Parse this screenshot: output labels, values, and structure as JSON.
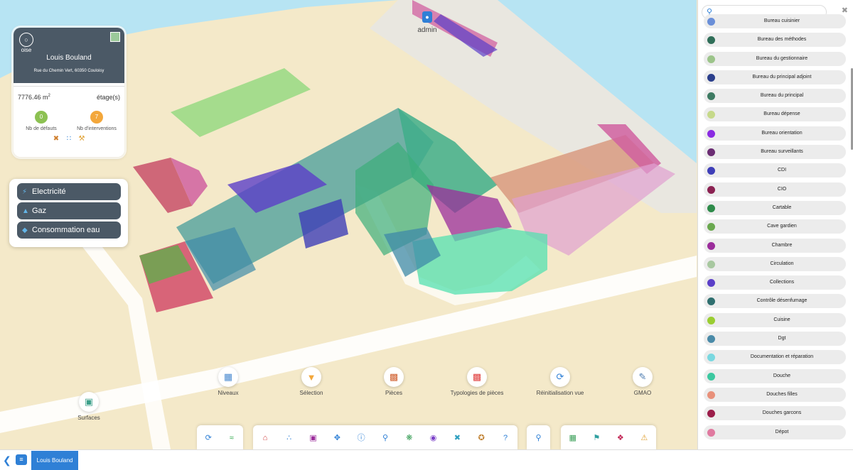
{
  "building": {
    "logo_text": "oise",
    "name": "Louis Bouland",
    "address": "Rue du Chemin Vert, 60350 Couloisy",
    "area_value": "7776.46 m",
    "area_unit_sup": "2",
    "floors_label": "étage(s)",
    "defects_count": "0",
    "defects_label": "Nb de défauts",
    "interventions_count": "7",
    "interventions_label": "Nb d'interventions",
    "defects_color": "#8cc152",
    "interventions_color": "#f3a73b"
  },
  "energy": {
    "items": [
      {
        "label": "Electricité",
        "icon": "lightning-icon"
      },
      {
        "label": "Gaz",
        "icon": "flame-icon"
      },
      {
        "label": "Consommation eau",
        "icon": "water-drop-icon"
      }
    ]
  },
  "map": {
    "user_label": "admin",
    "tools": [
      {
        "label": "Niveaux",
        "icon": "levels-icon"
      },
      {
        "label": "Sélection",
        "icon": "filter-icon"
      },
      {
        "label": "Pièces",
        "icon": "rooms-icon"
      },
      {
        "label": "Typologies de pièces",
        "icon": "room-types-icon"
      },
      {
        "label": "Réinitialisation vue",
        "icon": "reset-view-icon"
      },
      {
        "label": "GMAO",
        "icon": "gmao-icon"
      },
      {
        "label": "Surfaces",
        "icon": "surfaces-icon"
      }
    ]
  },
  "status": {
    "tab_label": "Louis Bouland"
  },
  "panel": {
    "search_placeholder": "",
    "items": [
      {
        "label": "Bureau cuisinier",
        "color": "#6a8fd8"
      },
      {
        "label": "Bureau des méthodes",
        "color": "#2f6e58"
      },
      {
        "label": "Bureau du gestionnaire",
        "color": "#9cc48a"
      },
      {
        "label": "Bureau du principal adjoint",
        "color": "#2b3f8c"
      },
      {
        "label": "Bureau du principal",
        "color": "#3e7a62"
      },
      {
        "label": "Bureau dépense",
        "color": "#c6d98a"
      },
      {
        "label": "Bureau orientation",
        "color": "#8a2be2"
      },
      {
        "label": "Bureau surveillants",
        "color": "#6b2d73"
      },
      {
        "label": "CDI",
        "color": "#3f3fb8"
      },
      {
        "label": "CIO",
        "color": "#8b2252"
      },
      {
        "label": "Cartable",
        "color": "#2e8b4a"
      },
      {
        "label": "Cave gardien",
        "color": "#6aa84f"
      },
      {
        "label": "Chambre",
        "color": "#9b2d9b"
      },
      {
        "label": "Circulation",
        "color": "#a8c8a0"
      },
      {
        "label": "Collections",
        "color": "#5b3fc8"
      },
      {
        "label": "Contrôle désenfumage",
        "color": "#2f6f6f"
      },
      {
        "label": "Cuisine",
        "color": "#9acd32"
      },
      {
        "label": "Dgt",
        "color": "#4a8aa8"
      },
      {
        "label": "Documentation et réparation",
        "color": "#7ad8e0"
      },
      {
        "label": "Douche",
        "color": "#3cc8a0"
      },
      {
        "label": "Douches filles",
        "color": "#e8907a"
      },
      {
        "label": "Douches garcons",
        "color": "#9b1d4a"
      },
      {
        "label": "Dépot",
        "color": "#e07aa0"
      }
    ]
  }
}
